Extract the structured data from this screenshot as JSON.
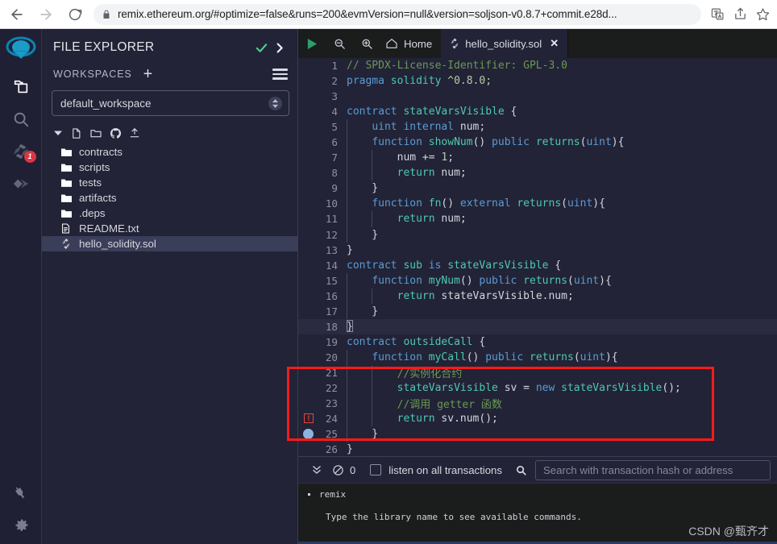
{
  "browser": {
    "back_icon": "arrow-left-icon",
    "forward_icon": "arrow-right-icon",
    "reload_icon": "reload-icon",
    "lock_icon": "lock-icon",
    "url": "remix.ethereum.org/#optimize=false&runs=200&evmVersion=null&version=soljson-v0.8.7+commit.e28d...",
    "translate_icon": "translate-icon",
    "share_icon": "share-icon",
    "bookmark_icon": "star-icon"
  },
  "rail": {
    "logo": "remix-logo-icon",
    "items": [
      {
        "name": "file-explorer-icon",
        "badge": null,
        "active": true
      },
      {
        "name": "search-icon",
        "badge": null,
        "active": false
      },
      {
        "name": "solidity-compiler-icon",
        "badge": "1",
        "active": false
      },
      {
        "name": "deploy-run-icon",
        "badge": null,
        "active": false
      }
    ],
    "bottom_items": [
      {
        "name": "plugin-manager-icon"
      },
      {
        "name": "settings-gear-icon"
      }
    ]
  },
  "explorer": {
    "title": "FILE EXPLORER",
    "check_icon": "check-icon",
    "chevron_icon": "chevron-right-icon",
    "workspaces_label": "WORKSPACES",
    "plus_label": "+",
    "menu_icon": "hamburger-menu-icon",
    "workspace_value": "default_workspace",
    "tree_toolbar": [
      "collapse-chevron-icon",
      "new-file-icon",
      "new-folder-icon",
      "github-icon",
      "upload-icon"
    ],
    "tree": [
      {
        "label": "contracts",
        "icon": "folder-icon",
        "selected": false
      },
      {
        "label": "scripts",
        "icon": "folder-icon",
        "selected": false
      },
      {
        "label": "tests",
        "icon": "folder-icon",
        "selected": false
      },
      {
        "label": "artifacts",
        "icon": "folder-icon",
        "selected": false
      },
      {
        "label": ".deps",
        "icon": "folder-icon",
        "selected": false
      },
      {
        "label": "README.txt",
        "icon": "file-text-icon",
        "selected": false
      },
      {
        "label": "hello_solidity.sol",
        "icon": "solidity-icon",
        "selected": true
      }
    ]
  },
  "editor": {
    "toolbar": {
      "run_icon": "run-play-icon",
      "zoom_out_icon": "zoom-out-icon",
      "zoom_in_icon": "zoom-in-icon",
      "home_icon": "home-icon",
      "home_label": "Home"
    },
    "tab": {
      "icon": "solidity-icon",
      "label": "hello_solidity.sol",
      "close_label": "✕"
    },
    "active_line": 18,
    "error_line": 24,
    "breakpoint_line": 25,
    "lines": [
      {
        "n": 1,
        "tokens": [
          {
            "t": "// SPDX-License-Identifier: GPL-3.0",
            "c": "c-com"
          }
        ]
      },
      {
        "n": 2,
        "tokens": [
          {
            "t": "pragma ",
            "c": "c-key"
          },
          {
            "t": "solidity ",
            "c": "c-type"
          },
          {
            "t": "^0.8.0;",
            "c": "c-num"
          }
        ]
      },
      {
        "n": 3,
        "tokens": []
      },
      {
        "n": 4,
        "tokens": [
          {
            "t": "contract ",
            "c": "c-key"
          },
          {
            "t": "stateVarsVisible ",
            "c": "c-type"
          },
          {
            "t": "{",
            "c": "c-brkt"
          }
        ]
      },
      {
        "n": 5,
        "tokens": [
          {
            "t": "    ",
            "c": "c-id"
          },
          {
            "t": "uint ",
            "c": "c-key"
          },
          {
            "t": "internal ",
            "c": "c-key"
          },
          {
            "t": "num;",
            "c": "c-id"
          }
        ]
      },
      {
        "n": 6,
        "tokens": [
          {
            "t": "    ",
            "c": "c-id"
          },
          {
            "t": "function ",
            "c": "c-key"
          },
          {
            "t": "showNum",
            "c": "c-type"
          },
          {
            "t": "() ",
            "c": "c-punct"
          },
          {
            "t": "public ",
            "c": "c-key"
          },
          {
            "t": "returns",
            "c": "c-type"
          },
          {
            "t": "(",
            "c": "c-punct"
          },
          {
            "t": "uint",
            "c": "c-key"
          },
          {
            "t": "){",
            "c": "c-punct"
          }
        ]
      },
      {
        "n": 7,
        "tokens": [
          {
            "t": "        num ",
            "c": "c-id"
          },
          {
            "t": "+= ",
            "c": "c-punct"
          },
          {
            "t": "1",
            "c": "c-num"
          },
          {
            "t": ";",
            "c": "c-punct"
          }
        ]
      },
      {
        "n": 8,
        "tokens": [
          {
            "t": "        ",
            "c": "c-id"
          },
          {
            "t": "return ",
            "c": "c-type"
          },
          {
            "t": "num;",
            "c": "c-id"
          }
        ]
      },
      {
        "n": 9,
        "tokens": [
          {
            "t": "    }",
            "c": "c-brkt"
          }
        ]
      },
      {
        "n": 10,
        "tokens": [
          {
            "t": "    ",
            "c": "c-id"
          },
          {
            "t": "function ",
            "c": "c-key"
          },
          {
            "t": "fn",
            "c": "c-type"
          },
          {
            "t": "() ",
            "c": "c-punct"
          },
          {
            "t": "external ",
            "c": "c-key"
          },
          {
            "t": "returns",
            "c": "c-type"
          },
          {
            "t": "(",
            "c": "c-punct"
          },
          {
            "t": "uint",
            "c": "c-key"
          },
          {
            "t": "){",
            "c": "c-punct"
          }
        ]
      },
      {
        "n": 11,
        "tokens": [
          {
            "t": "        ",
            "c": "c-id"
          },
          {
            "t": "return ",
            "c": "c-type"
          },
          {
            "t": "num;",
            "c": "c-id"
          }
        ]
      },
      {
        "n": 12,
        "tokens": [
          {
            "t": "    }",
            "c": "c-brkt"
          }
        ]
      },
      {
        "n": 13,
        "tokens": [
          {
            "t": "}",
            "c": "c-brkt"
          }
        ]
      },
      {
        "n": 14,
        "tokens": [
          {
            "t": "contract ",
            "c": "c-key"
          },
          {
            "t": "sub ",
            "c": "c-type"
          },
          {
            "t": "is ",
            "c": "c-key"
          },
          {
            "t": "stateVarsVisible ",
            "c": "c-type"
          },
          {
            "t": "{",
            "c": "c-brkt"
          }
        ]
      },
      {
        "n": 15,
        "tokens": [
          {
            "t": "    ",
            "c": "c-id"
          },
          {
            "t": "function ",
            "c": "c-key"
          },
          {
            "t": "myNum",
            "c": "c-type"
          },
          {
            "t": "() ",
            "c": "c-punct"
          },
          {
            "t": "public ",
            "c": "c-key"
          },
          {
            "t": "returns",
            "c": "c-type"
          },
          {
            "t": "(",
            "c": "c-punct"
          },
          {
            "t": "uint",
            "c": "c-key"
          },
          {
            "t": "){",
            "c": "c-punct"
          }
        ]
      },
      {
        "n": 16,
        "tokens": [
          {
            "t": "        ",
            "c": "c-id"
          },
          {
            "t": "return ",
            "c": "c-type"
          },
          {
            "t": "stateVarsVisible.num;",
            "c": "c-id"
          }
        ]
      },
      {
        "n": 17,
        "tokens": [
          {
            "t": "    }",
            "c": "c-brkt"
          }
        ]
      },
      {
        "n": 18,
        "tokens": [
          {
            "t": "}",
            "c": "c-brkt"
          }
        ]
      },
      {
        "n": 19,
        "tokens": [
          {
            "t": "contract ",
            "c": "c-key"
          },
          {
            "t": "outsideCall ",
            "c": "c-type"
          },
          {
            "t": "{",
            "c": "c-brkt"
          }
        ]
      },
      {
        "n": 20,
        "tokens": [
          {
            "t": "    ",
            "c": "c-id"
          },
          {
            "t": "function ",
            "c": "c-key"
          },
          {
            "t": "myCall",
            "c": "c-type"
          },
          {
            "t": "() ",
            "c": "c-punct"
          },
          {
            "t": "public ",
            "c": "c-key"
          },
          {
            "t": "returns",
            "c": "c-type"
          },
          {
            "t": "(",
            "c": "c-punct"
          },
          {
            "t": "uint",
            "c": "c-key"
          },
          {
            "t": "){",
            "c": "c-punct"
          }
        ]
      },
      {
        "n": 21,
        "tokens": [
          {
            "t": "        //实例化合约",
            "c": "c-com"
          }
        ]
      },
      {
        "n": 22,
        "tokens": [
          {
            "t": "        ",
            "c": "c-id"
          },
          {
            "t": "stateVarsVisible ",
            "c": "c-type"
          },
          {
            "t": "sv = ",
            "c": "c-id"
          },
          {
            "t": "new ",
            "c": "c-key"
          },
          {
            "t": "stateVarsVisible",
            "c": "c-type"
          },
          {
            "t": "();",
            "c": "c-punct"
          }
        ]
      },
      {
        "n": 23,
        "tokens": [
          {
            "t": "        //调用 getter 函数",
            "c": "c-com"
          }
        ]
      },
      {
        "n": 24,
        "tokens": [
          {
            "t": "        ",
            "c": "c-id"
          },
          {
            "t": "return ",
            "c": "c-type"
          },
          {
            "t": "sv.num();",
            "c": "c-id"
          }
        ]
      },
      {
        "n": 25,
        "tokens": [
          {
            "t": "    }",
            "c": "c-brkt"
          }
        ]
      },
      {
        "n": 26,
        "tokens": [
          {
            "t": "}",
            "c": "c-brkt"
          }
        ]
      }
    ]
  },
  "terminal": {
    "collapse_icon": "double-chevron-down-icon",
    "block_icon": "no-entry-icon",
    "count": "0",
    "checkbox_name": "listen-on-all-transactions-checkbox",
    "listen_label": "listen on all transactions",
    "search_icon": "search-icon",
    "search_placeholder": "Search with transaction hash or address",
    "search_value": "",
    "log_title": "remix",
    "log_body": "Type the library name to see available commands.",
    "watermark": "CSDN @甄齐才"
  },
  "colors": {
    "accent_red": "#ff1a1a",
    "badge_red": "#dc3545",
    "panel_bg": "#222336",
    "rail_bg": "#1f2034",
    "tabbar_bg": "#1b1c1c",
    "selected_row": "#3b3e59",
    "check_green": "#4ecb8d"
  }
}
